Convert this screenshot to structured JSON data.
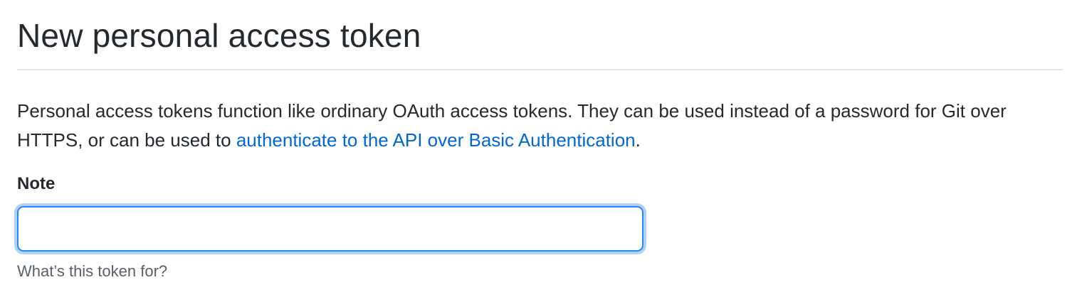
{
  "header": {
    "title": "New personal access token"
  },
  "intro": {
    "text_before_link": "Personal access tokens function like ordinary OAuth access tokens. They can be used instead of a password for Git over HTTPS, or can be used to ",
    "link_text": "authenticate to the API over Basic Authentication",
    "text_after_link": "."
  },
  "form": {
    "note": {
      "label": "Note",
      "value": "",
      "placeholder": "",
      "hint": "What’s this token for?"
    }
  },
  "colors": {
    "link": "#0366d6",
    "focus_border": "#2188ff",
    "divider": "#e1e4e8",
    "hint_text": "#586069",
    "body_text": "#24292e"
  }
}
